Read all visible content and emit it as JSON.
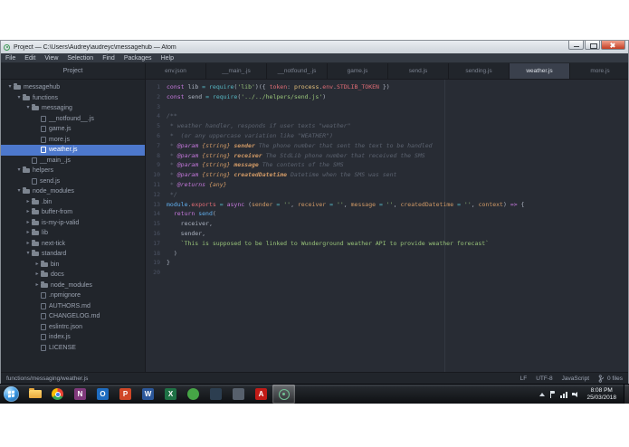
{
  "window": {
    "title": "Project — C:\\Users\\Audrey\\audreyc\\messagehub — Atom"
  },
  "menu": {
    "items": [
      "File",
      "Edit",
      "View",
      "Selection",
      "Find",
      "Packages",
      "Help"
    ]
  },
  "project_panel": {
    "header": "Project"
  },
  "tabs": [
    {
      "label": "env.json",
      "active": false
    },
    {
      "label": "__main_.js",
      "active": false
    },
    {
      "label": "__notfound_.js",
      "active": false
    },
    {
      "label": "game.js",
      "active": false
    },
    {
      "label": "send.js",
      "active": false
    },
    {
      "label": "sending.js",
      "active": false
    },
    {
      "label": "weather.js",
      "active": true
    },
    {
      "label": "more.js",
      "active": false
    }
  ],
  "tree": [
    {
      "label": "messagehub",
      "type": "folder",
      "expanded": true,
      "depth": 0,
      "selected": false
    },
    {
      "label": "functions",
      "type": "folder",
      "expanded": true,
      "depth": 1,
      "selected": false
    },
    {
      "label": "messaging",
      "type": "folder",
      "expanded": true,
      "depth": 2,
      "selected": false
    },
    {
      "label": "__notfound__.js",
      "type": "file",
      "depth": 3,
      "selected": false
    },
    {
      "label": "game.js",
      "type": "file",
      "depth": 3,
      "selected": false
    },
    {
      "label": "more.js",
      "type": "file",
      "depth": 3,
      "selected": false
    },
    {
      "label": "weather.js",
      "type": "file",
      "depth": 3,
      "selected": true
    },
    {
      "label": "__main_.js",
      "type": "file",
      "depth": 2,
      "selected": false
    },
    {
      "label": "helpers",
      "type": "folder",
      "expanded": true,
      "depth": 1,
      "selected": false
    },
    {
      "label": "send.js",
      "type": "file",
      "depth": 2,
      "selected": false
    },
    {
      "label": "node_modules",
      "type": "folder",
      "expanded": true,
      "depth": 1,
      "selected": false
    },
    {
      "label": ".bin",
      "type": "folder",
      "expanded": false,
      "depth": 2,
      "selected": false
    },
    {
      "label": "buffer-from",
      "type": "folder",
      "expanded": false,
      "depth": 2,
      "selected": false
    },
    {
      "label": "is-my-ip-valid",
      "type": "folder",
      "expanded": false,
      "depth": 2,
      "selected": false
    },
    {
      "label": "lib",
      "type": "folder",
      "expanded": false,
      "depth": 2,
      "selected": false
    },
    {
      "label": "next-tick",
      "type": "folder",
      "expanded": false,
      "depth": 2,
      "selected": false
    },
    {
      "label": "standard",
      "type": "folder",
      "expanded": true,
      "depth": 2,
      "selected": false
    },
    {
      "label": "bin",
      "type": "folder",
      "expanded": false,
      "depth": 3,
      "selected": false
    },
    {
      "label": "docs",
      "type": "folder",
      "expanded": false,
      "depth": 3,
      "selected": false
    },
    {
      "label": "node_modules",
      "type": "folder",
      "expanded": false,
      "depth": 3,
      "selected": false
    },
    {
      "label": ".npmignore",
      "type": "file",
      "depth": 3,
      "selected": false
    },
    {
      "label": "AUTHORS.md",
      "type": "file",
      "depth": 3,
      "selected": false
    },
    {
      "label": "CHANGELOG.md",
      "type": "file",
      "depth": 3,
      "selected": false
    },
    {
      "label": "eslintrc.json",
      "type": "file",
      "depth": 3,
      "selected": false
    },
    {
      "label": "index.js",
      "type": "file",
      "depth": 3,
      "selected": false
    },
    {
      "label": "LICENSE",
      "type": "file",
      "depth": 3,
      "selected": false
    }
  ],
  "editor": {
    "lines": [
      [
        [
          "k",
          "const"
        ],
        [
          "d",
          " lib "
        ],
        [
          "y",
          "="
        ],
        [
          "d",
          " "
        ],
        [
          "y",
          "require"
        ],
        [
          "d",
          "("
        ],
        [
          "s",
          "'lib'"
        ],
        [
          "d",
          ")({ "
        ],
        [
          "r",
          "token"
        ],
        [
          "d",
          ": "
        ],
        [
          "g",
          "process"
        ],
        [
          "d",
          "."
        ],
        [
          "r",
          "env"
        ],
        [
          "d",
          "."
        ],
        [
          "r",
          "STDLIB_TOKEN"
        ],
        [
          "d",
          " })"
        ]
      ],
      [
        [
          "k",
          "const"
        ],
        [
          "d",
          " send "
        ],
        [
          "y",
          "="
        ],
        [
          "d",
          " "
        ],
        [
          "y",
          "require"
        ],
        [
          "d",
          "("
        ],
        [
          "s",
          "'../../helpers/send.js'"
        ],
        [
          "d",
          ")"
        ]
      ],
      [],
      [
        [
          "c",
          "/**"
        ]
      ],
      [
        [
          "c",
          " * weather handler, responds if user texts \"weather\""
        ]
      ],
      [
        [
          "c",
          " *  (or any uppercase variation like \"WEATHER\")"
        ]
      ],
      [
        [
          "c",
          " * "
        ],
        [
          "t",
          "@param"
        ],
        [
          "c",
          " "
        ],
        [
          "p",
          "{string}"
        ],
        [
          "c",
          " "
        ],
        [
          "n",
          "sender"
        ],
        [
          "c",
          " The phone number that sent the text to be handled"
        ]
      ],
      [
        [
          "c",
          " * "
        ],
        [
          "t",
          "@param"
        ],
        [
          "c",
          " "
        ],
        [
          "p",
          "{string}"
        ],
        [
          "c",
          " "
        ],
        [
          "n",
          "receiver"
        ],
        [
          "c",
          " The StdLib phone number that received the SMS"
        ]
      ],
      [
        [
          "c",
          " * "
        ],
        [
          "t",
          "@param"
        ],
        [
          "c",
          " "
        ],
        [
          "p",
          "{string}"
        ],
        [
          "c",
          " "
        ],
        [
          "n",
          "message"
        ],
        [
          "c",
          " The contents of the SMS"
        ]
      ],
      [
        [
          "c",
          " * "
        ],
        [
          "t",
          "@param"
        ],
        [
          "c",
          " "
        ],
        [
          "p",
          "{string}"
        ],
        [
          "c",
          " "
        ],
        [
          "n",
          "createdDatetime"
        ],
        [
          "c",
          " Datetime when the SMS was sent"
        ]
      ],
      [
        [
          "c",
          " * "
        ],
        [
          "t",
          "@returns"
        ],
        [
          "c",
          " "
        ],
        [
          "p",
          "{any}"
        ]
      ],
      [
        [
          "c",
          " */"
        ]
      ],
      [
        [
          "b",
          "module"
        ],
        [
          "d",
          "."
        ],
        [
          "r",
          "exports"
        ],
        [
          "d",
          " "
        ],
        [
          "y",
          "="
        ],
        [
          "d",
          " "
        ],
        [
          "k",
          "async"
        ],
        [
          "d",
          " ("
        ],
        [
          "o",
          "sender"
        ],
        [
          "d",
          " "
        ],
        [
          "y",
          "="
        ],
        [
          "d",
          " "
        ],
        [
          "s",
          "''"
        ],
        [
          "d",
          ", "
        ],
        [
          "o",
          "receiver"
        ],
        [
          "d",
          " "
        ],
        [
          "y",
          "="
        ],
        [
          "d",
          " "
        ],
        [
          "s",
          "''"
        ],
        [
          "d",
          ", "
        ],
        [
          "o",
          "message"
        ],
        [
          "d",
          " "
        ],
        [
          "y",
          "="
        ],
        [
          "d",
          " "
        ],
        [
          "s",
          "''"
        ],
        [
          "d",
          ", "
        ],
        [
          "o",
          "createdDatetime"
        ],
        [
          "d",
          " "
        ],
        [
          "y",
          "="
        ],
        [
          "d",
          " "
        ],
        [
          "s",
          "''"
        ],
        [
          "d",
          ", "
        ],
        [
          "o",
          "context"
        ],
        [
          "d",
          ") "
        ],
        [
          "k",
          "=>"
        ],
        [
          "d",
          " {"
        ]
      ],
      [
        [
          "d",
          "  "
        ],
        [
          "k",
          "return"
        ],
        [
          "d",
          " "
        ],
        [
          "b",
          "send"
        ],
        [
          "d",
          "("
        ]
      ],
      [
        [
          "d",
          "    receiver,"
        ]
      ],
      [
        [
          "d",
          "    sender,"
        ]
      ],
      [
        [
          "d",
          "    "
        ],
        [
          "s",
          "`This is supposed to be linked to Wunderground weather API to provide weather forecast`"
        ]
      ],
      [
        [
          "d",
          "  )"
        ]
      ],
      [
        [
          "d",
          "}"
        ]
      ],
      []
    ]
  },
  "status_bar": {
    "path": "functions/messaging/weather.js",
    "line_ending": "LF",
    "encoding": "UTF-8",
    "language": "JavaScript",
    "git_files": "0 files"
  },
  "taskbar": {
    "icons": [
      {
        "name": "explorer-icon",
        "kind": "folder",
        "active": false
      },
      {
        "name": "chrome-icon",
        "kind": "chrome",
        "active": false
      },
      {
        "name": "onenote-icon",
        "kind": "letter",
        "letter": "N",
        "color": "#80397b",
        "active": false
      },
      {
        "name": "outlook-icon",
        "kind": "letter",
        "letter": "O",
        "color": "#1e6cc0",
        "active": false
      },
      {
        "name": "powerpoint-icon",
        "kind": "letter",
        "letter": "P",
        "color": "#d04727",
        "active": false
      },
      {
        "name": "word-icon",
        "kind": "letter",
        "letter": "W",
        "color": "#2b579a",
        "active": false
      },
      {
        "name": "excel-icon",
        "kind": "letter",
        "letter": "X",
        "color": "#1e7145",
        "active": false
      },
      {
        "name": "media-app-icon",
        "kind": "circle",
        "color": "#46a546",
        "active": false
      },
      {
        "name": "dev-app-icon",
        "kind": "letter",
        "letter": "",
        "color": "#2c3e50",
        "active": false
      },
      {
        "name": "utility-app-icon",
        "kind": "letter",
        "letter": "",
        "color": "#57606c",
        "active": false
      },
      {
        "name": "acrobat-icon",
        "kind": "letter",
        "letter": "A",
        "color": "#c11b17",
        "active": false
      },
      {
        "name": "atom-icon",
        "kind": "atom",
        "active": true
      }
    ],
    "clock": {
      "time": "8:08 PM",
      "date": "25/03/2018"
    }
  },
  "colors": {
    "tree_selection": "#4d78cc",
    "editor_background": "#282c34",
    "panel_background": "#21252b"
  }
}
